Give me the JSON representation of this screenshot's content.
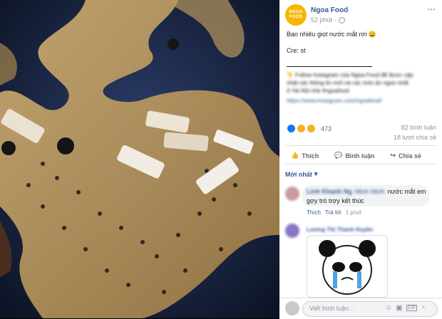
{
  "post": {
    "page_name": "Ngoa Food",
    "avatar_text": "NGOA\nFOOD",
    "time": "52 phút",
    "text": "Bao nhiêu giọt nước mắt rơi 😀",
    "credit": "Cre: st",
    "blurred_line1": "👇 Follow Instagram của Ngoa Food để được cập",
    "blurred_line2": "nhật các thông tin mới và các món ăn ngon nhất",
    "blurred_line3": "ở Hà Nội nhé #ngoafood",
    "link_text": "https://www.instagram.com/ngoafood/",
    "reactions_count": "473",
    "comments_count": "82 bình luận",
    "shares_count": "18 lượt chia sẻ"
  },
  "actions": {
    "like": "Thích",
    "comment": "Bình luận",
    "share": "Chia sẻ"
  },
  "sort": {
    "label": "Mới nhất"
  },
  "comments": [
    {
      "author": "Linh Khanh Ng",
      "tag": "Minh Minh",
      "text_tail": "nước mắt em",
      "text_line2": "gợy trò trợy kết thúc",
      "like": "Thích",
      "reply": "Trả lời",
      "time": "1 phút"
    },
    {
      "author": "Lương Thị Thanh Huyền"
    }
  ],
  "composer": {
    "placeholder": "Viết bình luận..."
  },
  "colors": {
    "brand": "#f7b500",
    "link": "#385898",
    "muted": "#90949c"
  },
  "icons": [
    "more-icon",
    "globe-icon",
    "like-icon",
    "comment-icon",
    "share-icon",
    "emoji-icon",
    "camera-icon",
    "gif-icon",
    "sticker-icon"
  ]
}
